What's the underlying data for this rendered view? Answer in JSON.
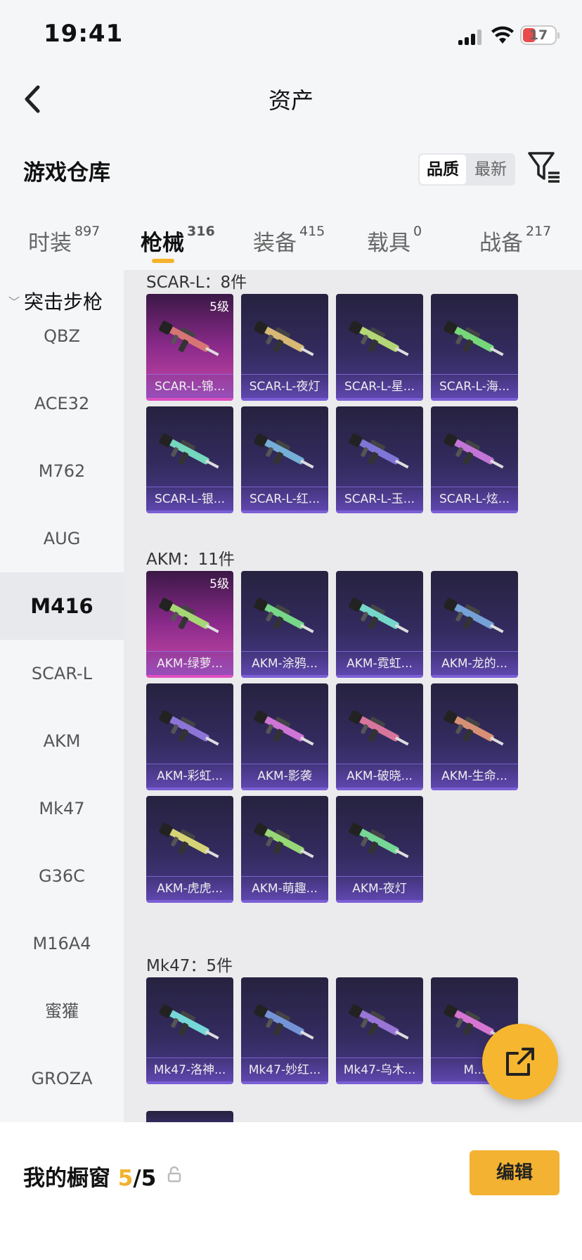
{
  "status": {
    "time": "19:41",
    "battery": "17"
  },
  "header": {
    "title": "资产"
  },
  "section": {
    "title": "游戏仓库",
    "sort_quality": "品质",
    "sort_newest": "最新"
  },
  "tabs": [
    {
      "label": "时装",
      "count": "897"
    },
    {
      "label": "枪械",
      "count": "316"
    },
    {
      "label": "装备",
      "count": "415"
    },
    {
      "label": "载具",
      "count": "0"
    },
    {
      "label": "战备",
      "count": "217"
    }
  ],
  "sidebar": {
    "category": "突击步枪",
    "items": [
      "QBZ",
      "ACE32",
      "M762",
      "AUG",
      "M416",
      "SCAR-L",
      "AKM",
      "Mk47",
      "G36C",
      "M16A4",
      "蜜獾",
      "GROZA"
    ]
  },
  "groups": [
    {
      "title": "SCAR-L：8件",
      "items": [
        {
          "name": "SCAR-L-锦...",
          "level": "5级"
        },
        {
          "name": "SCAR-L-夜灯"
        },
        {
          "name": "SCAR-L-星..."
        },
        {
          "name": "SCAR-L-海..."
        },
        {
          "name": "SCAR-L-银..."
        },
        {
          "name": "SCAR-L-红..."
        },
        {
          "name": "SCAR-L-玉..."
        },
        {
          "name": "SCAR-L-炫..."
        }
      ]
    },
    {
      "title": "AKM：11件",
      "items": [
        {
          "name": "AKM-绿萝...",
          "level": "5级"
        },
        {
          "name": "AKM-涂鸦..."
        },
        {
          "name": "AKM-霓虹..."
        },
        {
          "name": "AKM-龙的..."
        },
        {
          "name": "AKM-彩虹..."
        },
        {
          "name": "AKM-影袭"
        },
        {
          "name": "AKM-破晓..."
        },
        {
          "name": "AKM-生命..."
        },
        {
          "name": "AKM-虎虎..."
        },
        {
          "name": "AKM-萌趣..."
        },
        {
          "name": "AKM-夜灯"
        }
      ]
    },
    {
      "title": "Mk47：5件",
      "items": [
        {
          "name": "Mk47-洛神..."
        },
        {
          "name": "Mk47-妙红..."
        },
        {
          "name": "Mk47-乌木..."
        },
        {
          "name": "M..."
        }
      ]
    }
  ],
  "bottom": {
    "label": "我的橱窗",
    "current": "5",
    "total": "/5",
    "edit": "编辑"
  },
  "colors": {
    "accent": "#f5b32b",
    "card_purple": "#3a2f6e",
    "card_pink": "#c84aa8"
  }
}
